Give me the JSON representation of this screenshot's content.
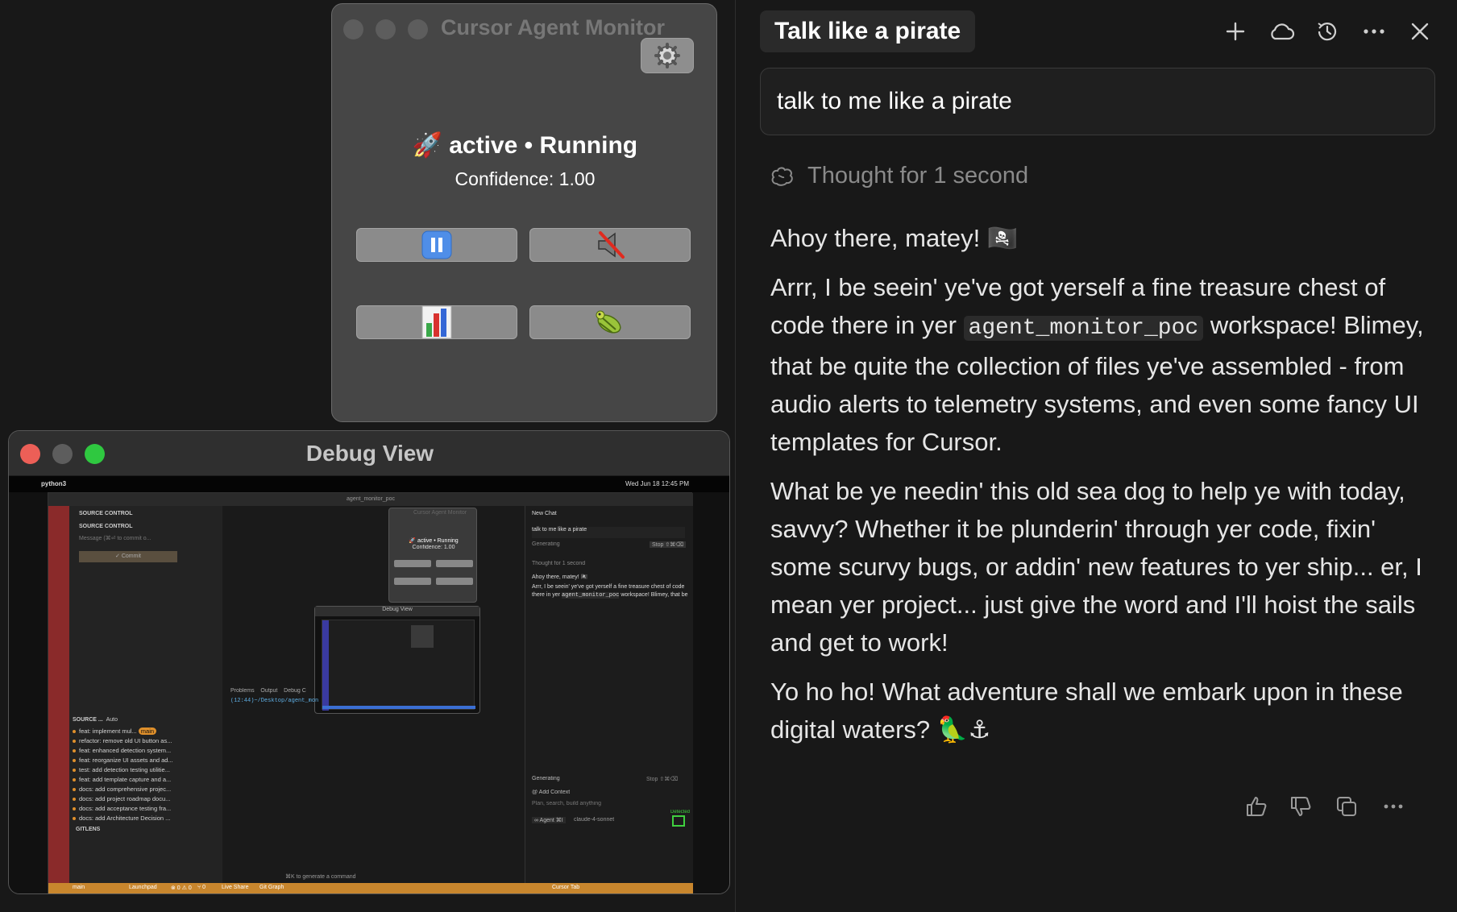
{
  "monitor": {
    "title": "Cursor Agent Monitor",
    "status_icon": "🚀",
    "status_text": "active • Running",
    "confidence_text": "Confidence: 1.00",
    "buttons": [
      {
        "icon": "pause-icon"
      },
      {
        "icon": "mute-speaker-icon"
      },
      {
        "icon": "bar-chart-icon"
      },
      {
        "icon": "bug-icon"
      }
    ]
  },
  "debug": {
    "title": "Debug View",
    "mini": {
      "menubar_app": "python3",
      "menubar_clock": "Wed Jun 18  12:45 PM",
      "workspace": "agent_monitor_poc",
      "source_control_header": "SOURCE CONTROL",
      "source_control_sub": "SOURCE CONTROL",
      "commit_placeholder": "Message (⌘⏎ to commit o...",
      "commit_button": "✓ Commit",
      "graph_header": "SOURCE ...",
      "graph_auto": "Auto",
      "branch_badge": "main",
      "commits": [
        "feat: implement mul...",
        "refactor: remove old UI button as...",
        "feat: enhanced detection system...",
        "feat: reorganize UI assets and ad...",
        "test: add detection testing utilitie...",
        "feat: add template capture and a...",
        "docs: add comprehensive projec...",
        "docs: add project roadmap docu...",
        "docs: add acceptance testing fra...",
        "docs: add Architecture Decision ..."
      ],
      "gitlens": "GITLENS",
      "panel_tabs": [
        "Problems",
        "Output",
        "Debug C"
      ],
      "terminal_line": "(12:44)~/Desktop/agent_mon",
      "generate_hint": "⌘K to generate a command",
      "chat_title": "New Chat",
      "chat_user": "talk to me like a pirate",
      "chat_generating": "Generating",
      "chat_stop": "Stop ⇧⌘⌫",
      "chat_thought": "Thought for 1 second",
      "chat_ahoy": "Ahoy there, matey! 🏴‍☠️",
      "chat_text1": "Arrr, I be seein' ye've got yerself a fine treasure chest of code there in yer",
      "chat_code": "agent_monitor_poc",
      "chat_text2": "workspace! Blimey, that be",
      "bottom_generating": "Generating",
      "bottom_stop": "Stop ⇧⌘⌫",
      "add_context": "@ Add Context",
      "input_placeholder": "Plan, search, build anything",
      "agent_label": "∞ Agent ⌘I",
      "model_label": "claude-4-sonnet",
      "detected": "Detected",
      "mini_monitor_title": "Cursor Agent Monitor",
      "mini_monitor_status": "🚀 active • Running",
      "mini_monitor_conf": "Confidence: 1.00",
      "mini_debug_title": "Debug View",
      "status_branch": "main",
      "status_launchpad": "Launchpad",
      "status_errors": "⊗ 0 ⚠ 0",
      "status_ports": "⑂ 0",
      "status_live": "Live Share",
      "status_graph": "Git Graph",
      "status_cursor_tab": "Cursor Tab"
    }
  },
  "chat": {
    "tab_title": "Talk like a pirate",
    "header_icons": [
      "plus-icon",
      "cloud-icon",
      "history-icon",
      "more-icon",
      "close-icon"
    ],
    "user_message": "talk to me like a pirate",
    "thought": "Thought for 1 second",
    "para1": "Ahoy there, matey! 🏴‍☠️",
    "para2_a": "Arrr, I be seein' ye've got yerself a fine treasure chest of code there in yer",
    "para2_code": "agent_monitor_poc",
    "para2_b": "workspace! Blimey, that be quite the collection of files ye've assembled - from audio alerts to telemetry systems, and even some fancy UI templates for Cursor.",
    "para3": "What be ye needin' this old sea dog to help ye with today, savvy? Whether it be plunderin' through yer code, fixin' some scurvy bugs, or addin' new features to yer ship... er, I mean yer project... just give the word and I'll hoist the sails and get to work!",
    "para4": "Yo ho ho! What adventure shall we embark upon in these digital waters? 🦜⚓",
    "feedback_icons": [
      "thumbs-up-icon",
      "thumbs-down-icon",
      "copy-icon",
      "more-icon"
    ]
  }
}
